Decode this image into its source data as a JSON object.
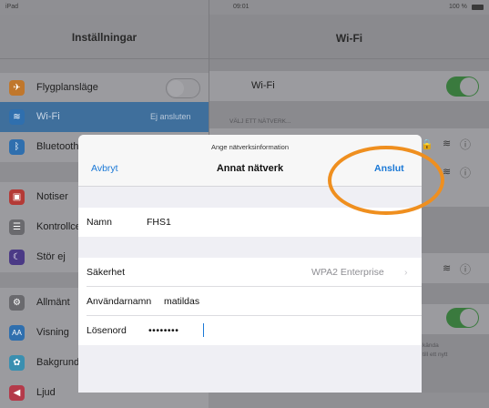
{
  "status_bar": {
    "carrier": "iPad",
    "time": "09:01",
    "battery": "100 %"
  },
  "settings": {
    "title": "Inställningar",
    "items": [
      {
        "label": "Flygplansläge",
        "icon": "airplane-icon",
        "color": "#c0772c",
        "value": ""
      },
      {
        "label": "Wi-Fi",
        "icon": "wifi-icon",
        "color": "#2f6fae",
        "value": "Ej ansluten"
      },
      {
        "label": "Bluetooth",
        "icon": "bluetooth-icon",
        "color": "#2f6fae",
        "value": ""
      },
      {
        "label": "Notiser",
        "icon": "notifications-icon",
        "color": "#b43a36",
        "value": ""
      },
      {
        "label": "Kontrollcenter",
        "icon": "control-center-icon",
        "color": "#6a6a6e",
        "value": ""
      },
      {
        "label": "Stör ej",
        "icon": "moon-icon",
        "color": "#4b3a86",
        "value": ""
      },
      {
        "label": "Allmänt",
        "icon": "gear-icon",
        "color": "#6a6a6e",
        "value": ""
      },
      {
        "label": "Visning",
        "icon": "display-icon",
        "color": "#2f6fae",
        "value": ""
      },
      {
        "label": "Bakgrund",
        "icon": "wallpaper-icon",
        "color": "#3a8fb0",
        "value": ""
      },
      {
        "label": "Ljud",
        "icon": "sound-icon",
        "color": "#b43a4a",
        "value": ""
      }
    ]
  },
  "wifi_pane": {
    "title": "Wi-Fi",
    "wifi_label": "Wi-Fi",
    "section_header": "VÄLJ ETT NÄTVERK...",
    "ask_note_1": "kända",
    "ask_note_2": "till ett nytt"
  },
  "modal": {
    "header_hint": "Ange nätverksinformation",
    "title": "Annat nätverk",
    "cancel": "Avbryt",
    "connect": "Anslut",
    "name_label": "Namn",
    "name_value": "FHS1",
    "security_label": "Säkerhet",
    "security_value": "WPA2 Enterprise",
    "username_label": "Användarnamn",
    "username_value": "matildas",
    "password_label": "Lösenord",
    "password_value": "••••••••"
  },
  "colors": {
    "accent_blue": "#1a78d6",
    "highlight_ring": "#ef8f1f",
    "toggle_green": "#3a7a3e"
  }
}
